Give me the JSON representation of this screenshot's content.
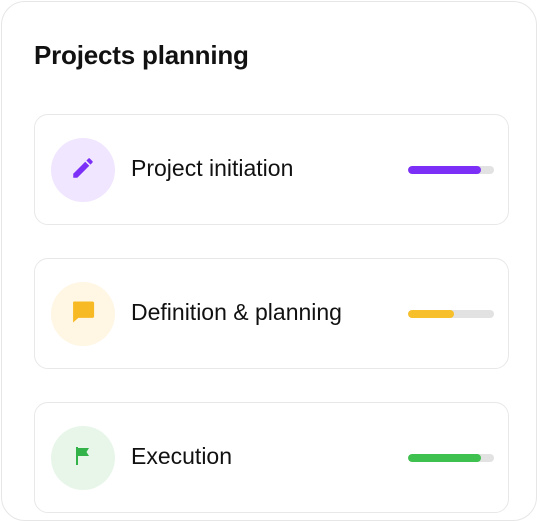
{
  "panel": {
    "title": "Projects planning"
  },
  "stages": [
    {
      "label": "Project initiation",
      "icon": "pencil-icon",
      "icon_color": "#7b2ff7",
      "icon_bg": "#f0e6ff",
      "progress": 0.85,
      "progress_color": "#7b2ff7"
    },
    {
      "label": "Definition & planning",
      "icon": "chat-bubble-icon",
      "icon_color": "#f7b924",
      "icon_bg": "#fff6e3",
      "progress": 0.53,
      "progress_color": "#f7bf2a"
    },
    {
      "label": "Execution",
      "icon": "flag-icon",
      "icon_color": "#34b24a",
      "icon_bg": "#e8f6ea",
      "progress": 0.85,
      "progress_color": "#3fc14f"
    }
  ]
}
